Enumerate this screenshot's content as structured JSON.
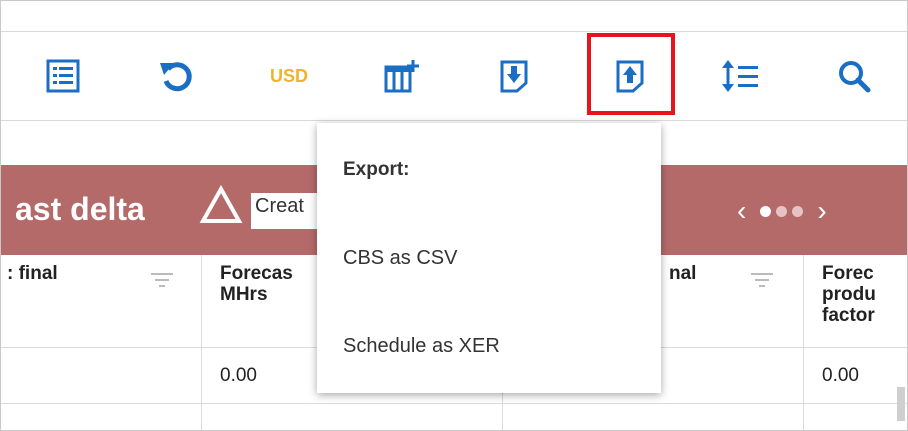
{
  "toolbar": {
    "currency_label": "USD",
    "icons": [
      "list-view-icon",
      "refresh-icon",
      "currency",
      "add-column-icon",
      "import-icon",
      "export-icon",
      "row-height-icon",
      "search-icon"
    ]
  },
  "banner": {
    "title": "ast delta",
    "input_value": "Creat",
    "accent_color": "#b56a6a"
  },
  "table": {
    "columns": [
      {
        "label": ": final"
      },
      {
        "label": "Forecas\nMHrs"
      },
      {
        "label": "nal"
      },
      {
        "label": "Forec\nprodu\nfactor"
      }
    ],
    "row1": [
      "",
      "0.00",
      "",
      "0.00"
    ]
  },
  "export_menu": {
    "title": "Export:",
    "items": [
      "CBS as CSV",
      "Schedule as XER"
    ]
  },
  "colors": {
    "highlight": "#e8141c",
    "icon_blue": "#1a6fc4",
    "usd": "#f0b429"
  }
}
